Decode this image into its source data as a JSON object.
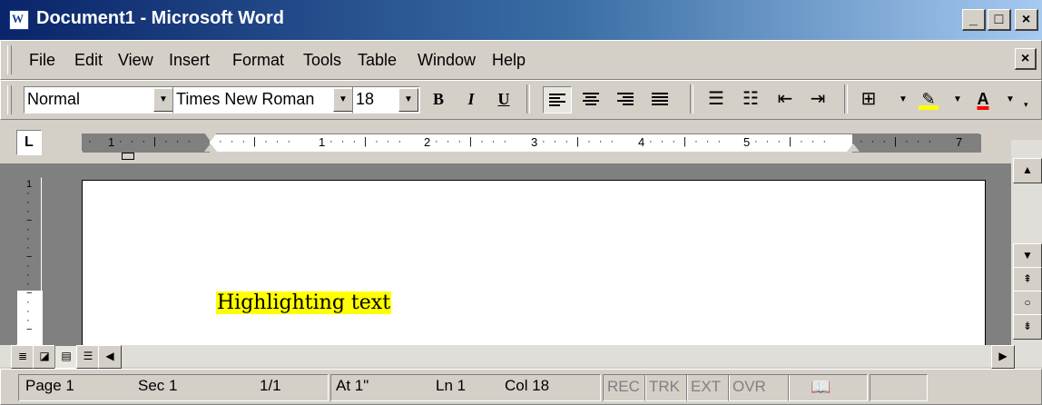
{
  "window": {
    "title": "Document1 - Microsoft Word",
    "icon": "word-doc-icon"
  },
  "caption_buttons": {
    "minimize": "_",
    "maximize": "□",
    "close": "×"
  },
  "menu": [
    "File",
    "Edit",
    "View",
    "Insert",
    "Format",
    "Tools",
    "Table",
    "Window",
    "Help"
  ],
  "doc_close": "×",
  "toolbar": {
    "style": "Normal",
    "font": "Times New Roman",
    "size": "18",
    "bold": "B",
    "italic": "I",
    "underline": "U",
    "font_color": "A",
    "highlight_color": "#ffff00",
    "font_color_bar": "#ff0000"
  },
  "ruler": {
    "numbers": [
      "1",
      "1",
      "2",
      "3",
      "4",
      "5",
      "7"
    ]
  },
  "document": {
    "text": "Highlighting text",
    "highlight": "#ffff00"
  },
  "status": {
    "page": "Page 1",
    "section": "Sec 1",
    "pages": "1/1",
    "at": "At 1\"",
    "line": "Ln 1",
    "col": "Col 18",
    "rec": "REC",
    "trk": "TRK",
    "ext": "EXT",
    "ovr": "OVR"
  }
}
